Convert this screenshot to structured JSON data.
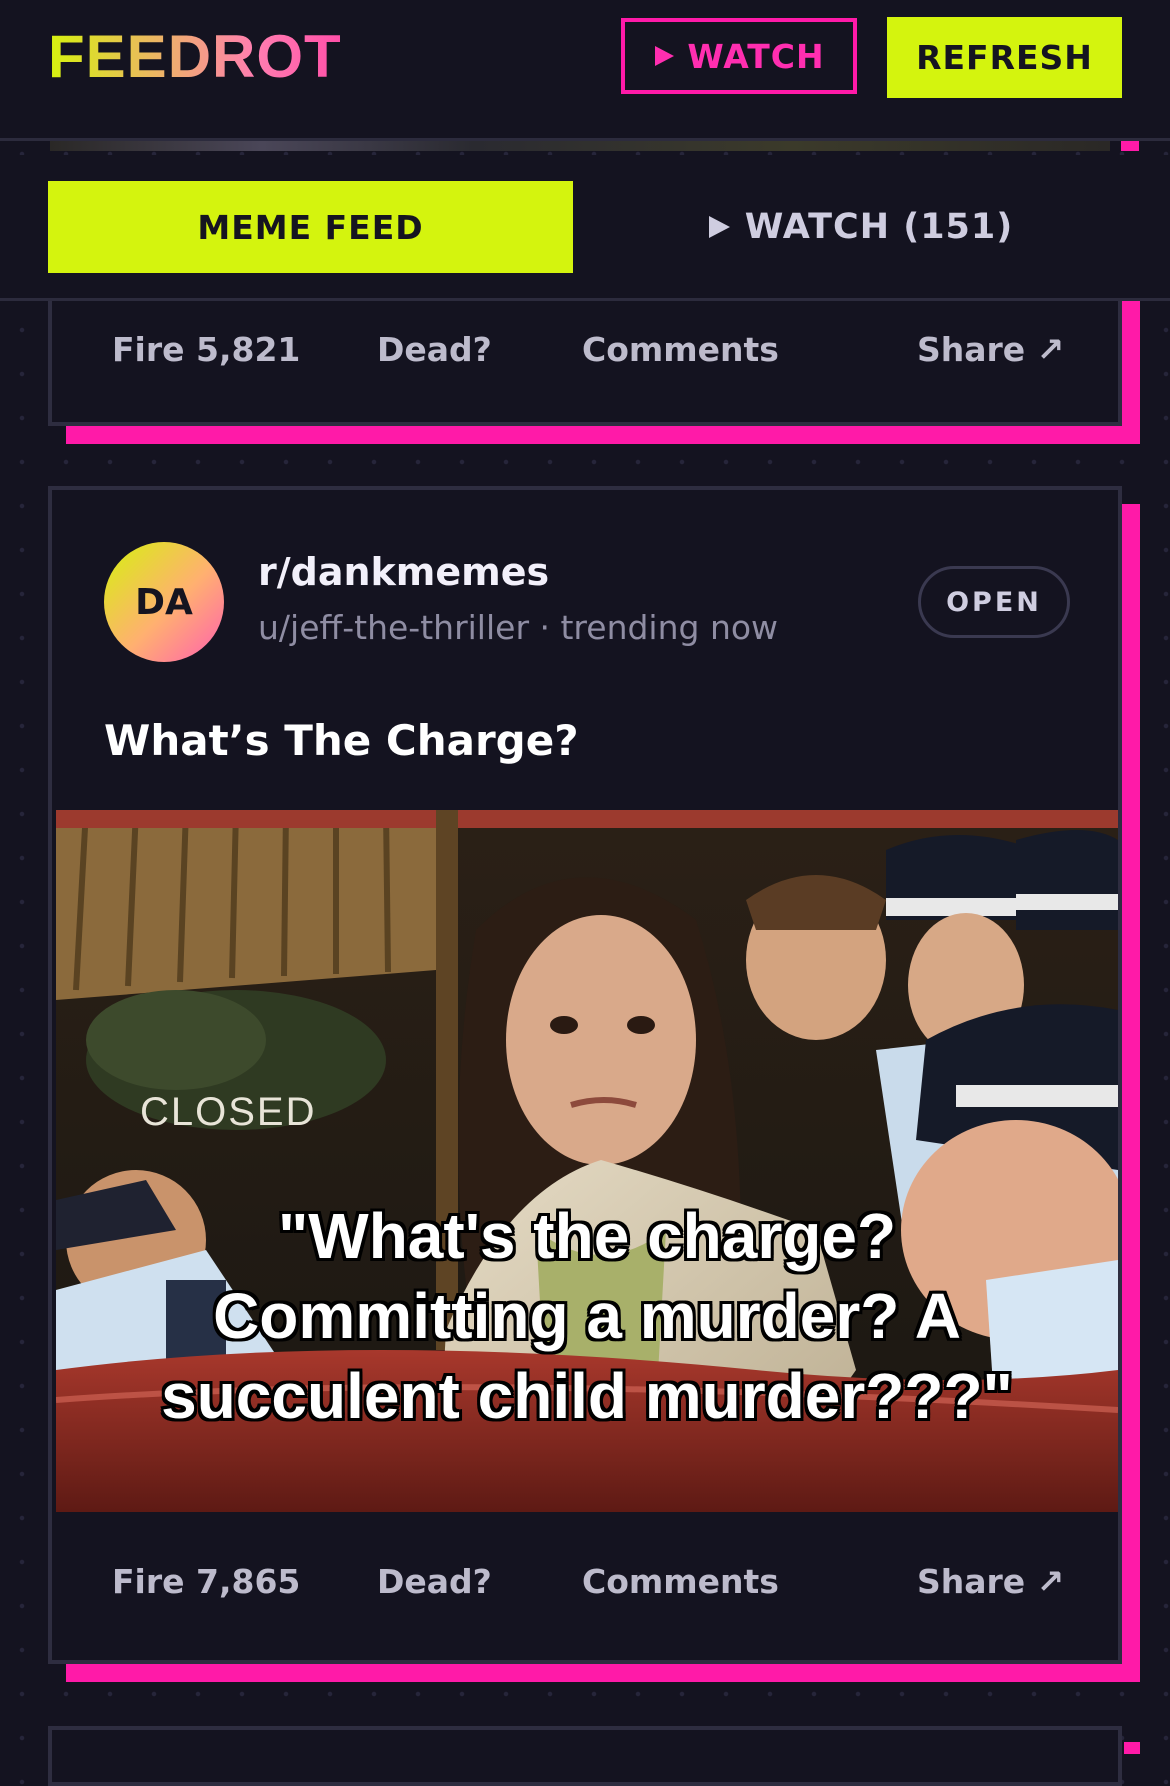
{
  "header": {
    "logo": "FEEDROT",
    "watch_button": "WATCH",
    "refresh_button": "REFRESH"
  },
  "tabs": {
    "meme_feed": "MEME FEED",
    "watch": "WATCH (151)"
  },
  "posts": [
    {
      "actions": {
        "fire": "Fire 5,821",
        "dead": "Dead?",
        "comments": "Comments",
        "share": "Share ↗"
      }
    },
    {
      "avatar_initials": "DA",
      "subreddit": "r/dankmemes",
      "meta": "u/jeff-the-thriller · trending now",
      "open_button": "OPEN",
      "title": "What’s The Charge?",
      "image": {
        "sign_text": "CLOSED",
        "caption_lines": [
          "\"What's  the charge?",
          "Committing a murder? A",
          "succulent child murder???\""
        ]
      },
      "actions": {
        "fire": "Fire 7,865",
        "dead": "Dead?",
        "comments": "Comments",
        "share": "Share ↗"
      }
    }
  ],
  "colors": {
    "background": "#141320",
    "accent_lime": "#d4f40e",
    "accent_pink": "#ff1aa8",
    "border": "#2e2d40"
  },
  "icons": {
    "play": "play-icon",
    "share_arrow": "arrow-up-right-icon"
  }
}
